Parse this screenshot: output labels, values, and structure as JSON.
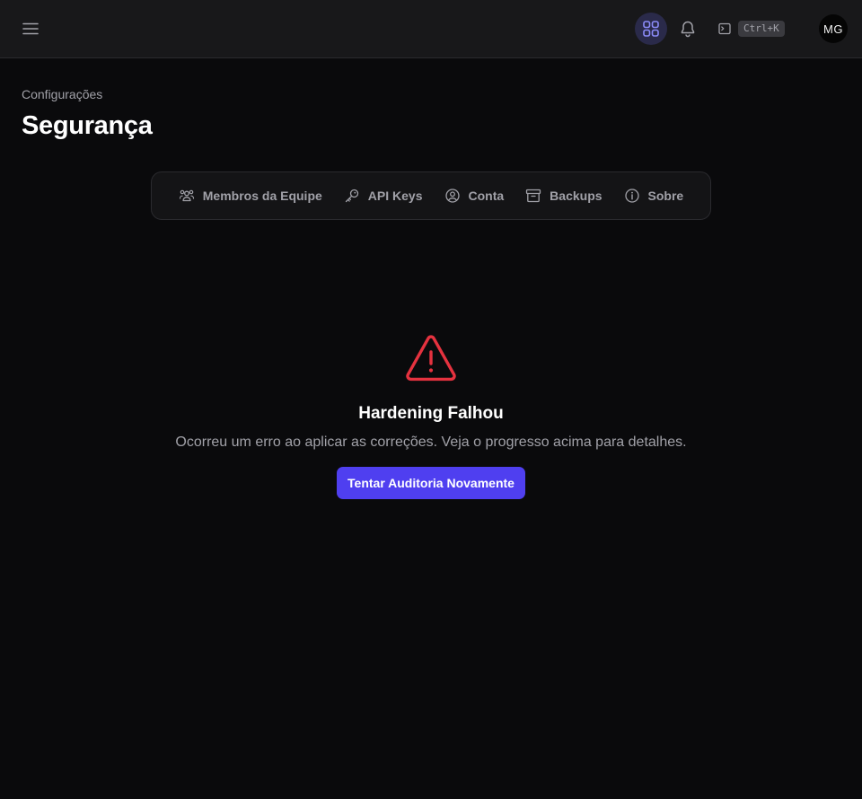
{
  "header": {
    "menu_icon": "hamburger-menu-icon",
    "apps_icon": "grid-icon",
    "bell_icon": "bell-icon",
    "command_icon": "terminal-icon",
    "shortcut": "Ctrl+K",
    "avatar_initials": "MG"
  },
  "page": {
    "breadcrumb": "Configurações",
    "title": "Segurança"
  },
  "tabs": [
    {
      "label": "Membros da Equipe",
      "icon": "users-icon"
    },
    {
      "label": "API Keys",
      "icon": "key-icon"
    },
    {
      "label": "Conta",
      "icon": "user-circle-icon"
    },
    {
      "label": "Backups",
      "icon": "archive-icon"
    },
    {
      "label": "Sobre",
      "icon": "info-icon"
    }
  ],
  "error": {
    "icon": "warning-triangle-icon",
    "title": "Hardening Falhou",
    "description": "Ocorreu um erro ao aplicar as correções. Veja o progresso acima para detalhes.",
    "button_label": "Tentar Auditoria Novamente"
  },
  "colors": {
    "background": "#0a0a0c",
    "accent": "#4f3ff0",
    "error": "#e5323f"
  }
}
